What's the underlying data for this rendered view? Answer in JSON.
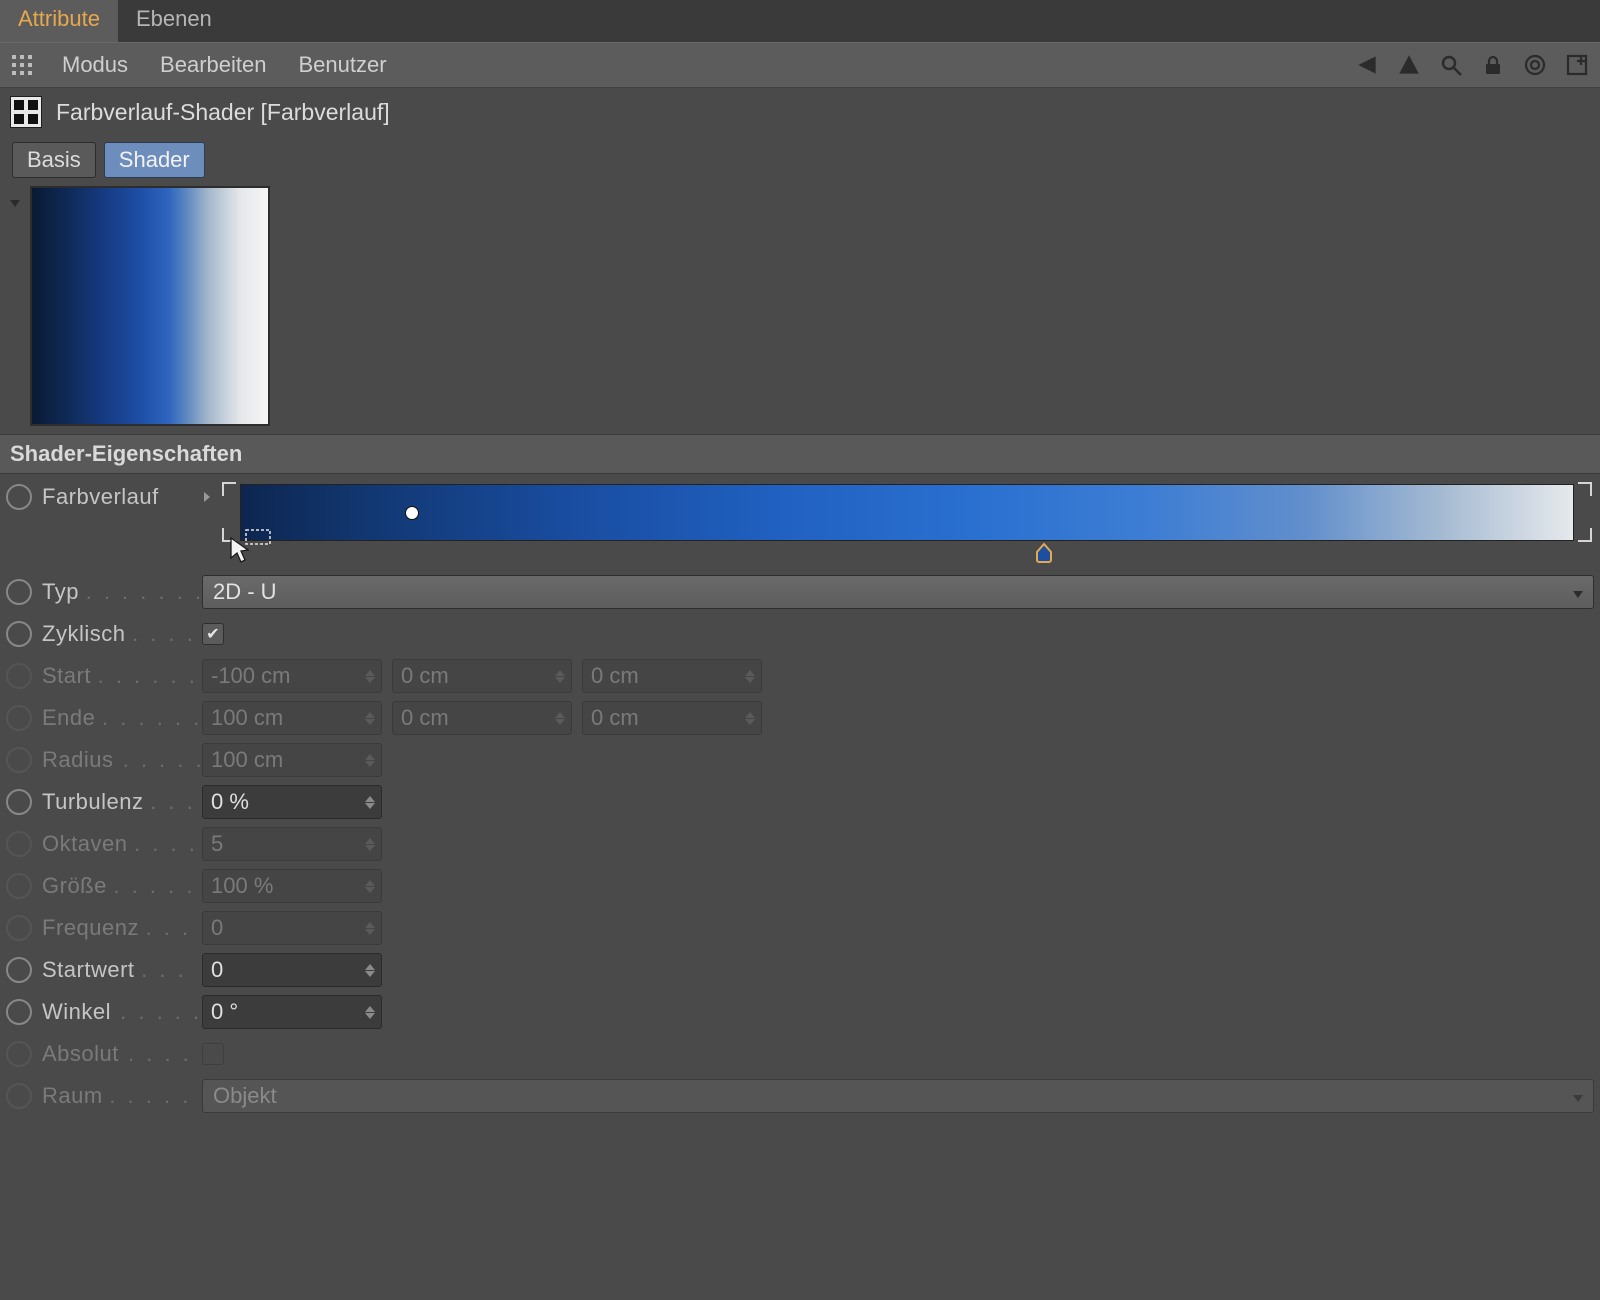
{
  "tabs": {
    "attribute": "Attribute",
    "ebenen": "Ebenen"
  },
  "menubar": {
    "modus": "Modus",
    "bearbeiten": "Bearbeiten",
    "benutzer": "Benutzer"
  },
  "icons": {
    "grid": "grid-icon",
    "navBack": "nav-back-icon",
    "navUp": "nav-up-icon",
    "search": "search-icon",
    "lock": "lock-icon",
    "target": "target-icon",
    "newWindow": "new-window-icon"
  },
  "object": {
    "title": "Farbverlauf-Shader [Farbverlauf]"
  },
  "subtabs": {
    "basis": "Basis",
    "shader": "Shader"
  },
  "sections": {
    "shaderProps": "Shader-Eigenschaften"
  },
  "props": {
    "farbverlauf": {
      "label": "Farbverlauf"
    },
    "typ": {
      "label": "Typ",
      "value": "2D - U"
    },
    "zyklisch": {
      "label": "Zyklisch",
      "checked": true
    },
    "start": {
      "label": "Start",
      "x": "-100 cm",
      "y": "0 cm",
      "z": "0 cm"
    },
    "ende": {
      "label": "Ende",
      "x": "100 cm",
      "y": "0 cm",
      "z": "0 cm"
    },
    "radius": {
      "label": "Radius",
      "value": "100 cm"
    },
    "turbulenz": {
      "label": "Turbulenz",
      "value": "0 %"
    },
    "oktaven": {
      "label": "Oktaven",
      "value": "5"
    },
    "groesse": {
      "label": "Größe",
      "value": "100 %"
    },
    "frequenz": {
      "label": "Frequenz",
      "value": "0"
    },
    "startwert": {
      "label": "Startwert",
      "value": "0"
    },
    "winkel": {
      "label": "Winkel",
      "value": "0 °"
    },
    "absolut": {
      "label": "Absolut",
      "checked": false
    },
    "raum": {
      "label": "Raum",
      "value": "Objekt"
    }
  },
  "gradient": {
    "colorLeft": "#0d2650",
    "colorRight": "#e6e9ec",
    "nodePos": 0.14,
    "stopPos": 0.6,
    "stopColor": "#1c4ea2",
    "selectedStopOutline": "#e6a84d"
  }
}
